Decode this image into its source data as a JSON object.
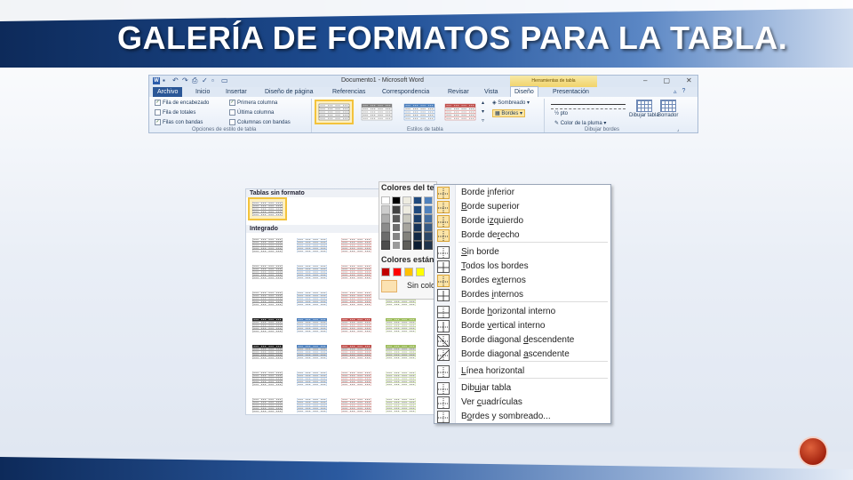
{
  "slide": {
    "title": "GALERÍA DE FORMATOS PARA LA TABLA."
  },
  "ribbon": {
    "window_title": "Documento1 - Microsoft Word",
    "context_tab": "Herramientas de tabla",
    "tabs": [
      "Archivo",
      "Inicio",
      "Insertar",
      "Diseño de página",
      "Referencias",
      "Correspondencia",
      "Revisar",
      "Vista",
      "Diseño",
      "Presentación"
    ],
    "active_tab": "Diseño",
    "options": {
      "col1": [
        {
          "label": "Fila de encabezado",
          "checked": true
        },
        {
          "label": "Fila de totales",
          "checked": false
        },
        {
          "label": "Filas con bandas",
          "checked": true
        }
      ],
      "col2": [
        {
          "label": "Primera columna",
          "checked": true
        },
        {
          "label": "Última columna",
          "checked": false
        },
        {
          "label": "Columnas con bandas",
          "checked": false
        }
      ],
      "group_label": "Opciones de estilo de tabla"
    },
    "styles_group_label": "Estilos de tabla",
    "sombreado": "Sombreado",
    "bordes": "Bordes",
    "pen_weight": "½ pto",
    "pen_color": "Color de la pluma",
    "draw_table": "Dibujar tabla",
    "eraser": "Borrador",
    "draw_group_label": "Dibujar bordes"
  },
  "gallery": {
    "section_plain": "Tablas sin formato",
    "section_builtin": "Integrado"
  },
  "colors_panel": {
    "theme_header": "Colores del tema",
    "standard_header": "Colores estándar",
    "no_color": "Sin color",
    "theme_columns": [
      "#ffffff",
      "#000000",
      "#eeece1",
      "#1f497d",
      "#4f81bd",
      "#c0504d"
    ],
    "standard_colors": [
      "#c00000",
      "#ff0000",
      "#ffc000",
      "#ffff00"
    ]
  },
  "border_menu": {
    "items": [
      {
        "pre": "Borde ",
        "u": "i",
        "post": "nferior"
      },
      {
        "pre": "",
        "u": "B",
        "post": "orde superior"
      },
      {
        "pre": "Borde i",
        "u": "z",
        "post": "quierdo"
      },
      {
        "pre": "Borde de",
        "u": "r",
        "post": "echo"
      },
      {
        "pre": "",
        "u": "S",
        "post": "in borde"
      },
      {
        "pre": "",
        "u": "T",
        "post": "odos los bordes"
      },
      {
        "pre": "Bordes e",
        "u": "x",
        "post": "ternos"
      },
      {
        "pre": "Bordes ",
        "u": "i",
        "post": "nternos"
      },
      {
        "pre": "Borde ",
        "u": "h",
        "post": "orizontal interno"
      },
      {
        "pre": "Borde ",
        "u": "v",
        "post": "ertical interno"
      },
      {
        "pre": "Borde diagonal ",
        "u": "d",
        "post": "escendente"
      },
      {
        "pre": "Borde diagonal ",
        "u": "a",
        "post": "scendente"
      },
      {
        "pre": "",
        "u": "L",
        "post": "ínea horizontal"
      },
      {
        "pre": "Dib",
        "u": "u",
        "post": "jar tabla"
      },
      {
        "pre": "Ver ",
        "u": "c",
        "post": "uadrículas"
      },
      {
        "pre": "B",
        "u": "o",
        "post": "rdes y sombreado..."
      }
    ]
  }
}
